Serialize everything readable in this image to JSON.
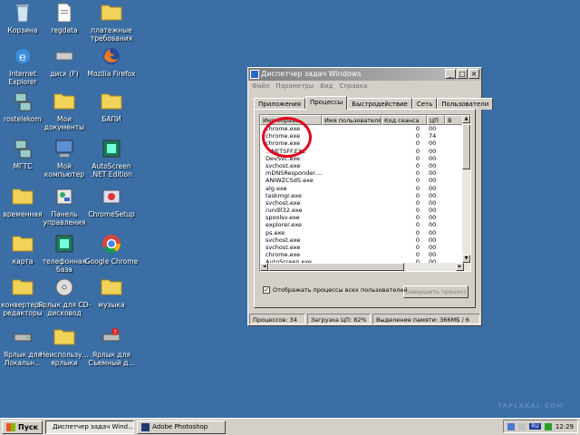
{
  "desktop": {
    "icons": [
      {
        "label": "Корзина",
        "type": "bin"
      },
      {
        "label": "regdata",
        "type": "doc"
      },
      {
        "label": "платежные требования",
        "type": "folder"
      },
      {
        "label": "Internet Explorer",
        "type": "ie"
      },
      {
        "label": "диск (F)",
        "type": "disk"
      },
      {
        "label": "Mozilla Firefox",
        "type": "firefox"
      },
      {
        "label": "rostelekom",
        "type": "net"
      },
      {
        "label": "Мои документы",
        "type": "folder"
      },
      {
        "label": "БАПИ",
        "type": "folder"
      },
      {
        "label": "МГТС",
        "type": "net"
      },
      {
        "label": "Мой компьютер",
        "type": "computer"
      },
      {
        "label": "AutoScreen .NET Edition",
        "type": "app"
      },
      {
        "label": "временная",
        "type": "folder"
      },
      {
        "label": "Панель управления",
        "type": "control"
      },
      {
        "label": "ChromeSetup",
        "type": "setup"
      },
      {
        "label": "карта",
        "type": "folder"
      },
      {
        "label": "телефонная база",
        "type": "app"
      },
      {
        "label": "Google Chrome",
        "type": "chrome"
      },
      {
        "label": "конвертеры редакторы",
        "type": "folder"
      },
      {
        "label": "Ярлык для CD-дисковод",
        "type": "cd"
      },
      {
        "label": "музыка",
        "type": "folder"
      },
      {
        "label": "Ярлык для Локальн...",
        "type": "drive"
      },
      {
        "label": "Неиспользу... ярлыки",
        "type": "folder"
      },
      {
        "label": "Ярлык для Съемный д...",
        "type": "usb"
      }
    ]
  },
  "taskmgr": {
    "title": "Диспетчер задач Windows",
    "menu": [
      "Файл",
      "Параметры",
      "Вид",
      "Справка"
    ],
    "tabs": [
      "Приложения",
      "Процессы",
      "Быстродействие",
      "Сеть",
      "Пользователи"
    ],
    "columns": [
      "Имя образа",
      "Имя пользователя",
      "Код сеанса",
      "ЦП",
      "В"
    ],
    "rows": [
      {
        "name": "chrome.exe",
        "user": "",
        "session": "0",
        "cpu": "00"
      },
      {
        "name": "chrome.exe",
        "user": "",
        "session": "0",
        "cpu": "74"
      },
      {
        "name": "chrome.exe",
        "user": "",
        "session": "0",
        "cpu": "00"
      },
      {
        "name": "...NETSFF.EXE",
        "user": "",
        "session": "0",
        "cpu": "00"
      },
      {
        "name": "DevSvc.exe",
        "user": "",
        "session": "0",
        "cpu": "00"
      },
      {
        "name": "svchost.exe",
        "user": "",
        "session": "0",
        "cpu": "00"
      },
      {
        "name": "mDNSResponder....",
        "user": "",
        "session": "0",
        "cpu": "00"
      },
      {
        "name": "ANIWZCSdS.exe",
        "user": "",
        "session": "0",
        "cpu": "00"
      },
      {
        "name": "alg.exe",
        "user": "",
        "session": "0",
        "cpu": "00"
      },
      {
        "name": "taskmgr.exe",
        "user": "",
        "session": "0",
        "cpu": "00"
      },
      {
        "name": "svchost.exe",
        "user": "",
        "session": "0",
        "cpu": "00"
      },
      {
        "name": "rundll32.exe",
        "user": "",
        "session": "0",
        "cpu": "00"
      },
      {
        "name": "spoolsv.exe",
        "user": "",
        "session": "0",
        "cpu": "00"
      },
      {
        "name": "explorer.exe",
        "user": "",
        "session": "0",
        "cpu": "00"
      },
      {
        "name": "ps.exe",
        "user": "",
        "session": "0",
        "cpu": "00"
      },
      {
        "name": "svchost.exe",
        "user": "",
        "session": "0",
        "cpu": "00"
      },
      {
        "name": "svchost.exe",
        "user": "",
        "session": "0",
        "cpu": "00"
      },
      {
        "name": "chrome.exe",
        "user": "",
        "session": "0",
        "cpu": "00"
      },
      {
        "name": "AutoScreen.exe",
        "user": "",
        "session": "0",
        "cpu": "00"
      }
    ],
    "show_all_label": "Отображать процессы всех пользователей",
    "show_all_checked": true,
    "end_process_label": "Завершить процесс",
    "status": {
      "processes": "Процессов: 34",
      "cpu": "Загрузка ЦП: 82%",
      "memory": "Выделение памяти: 366МБ / 6"
    },
    "highlight_color": "#e4001e"
  },
  "taskbar": {
    "start_label": "Пуск",
    "tasks": [
      {
        "label": "Диспетчер задач Wind...",
        "active": true
      },
      {
        "label": "Adobe Photoshop",
        "active": false
      }
    ],
    "tray_lang": "RU",
    "clock": "12:29"
  },
  "watermark": "YAPLAKAL.COM",
  "colors": {
    "desktop": "#3a6ea5",
    "face": "#d4d0c8"
  }
}
